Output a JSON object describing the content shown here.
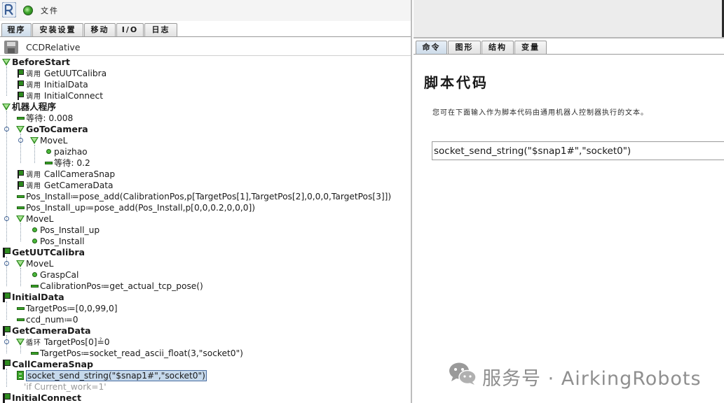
{
  "titlebar": {
    "file_menu": "文件"
  },
  "main_tabs": [
    "程序",
    "安装设置",
    "移动",
    "I/O",
    "日志"
  ],
  "program": {
    "name": "CCDRelative"
  },
  "tree": [
    {
      "indent": 0,
      "icon": "triangle",
      "bold": true,
      "text": "BeforeStart"
    },
    {
      "indent": 1,
      "icon": "flag",
      "kw": "调用",
      "text": "GetUUTCalibra"
    },
    {
      "indent": 1,
      "icon": "flag",
      "kw": "调用",
      "text": "InitialData"
    },
    {
      "indent": 1,
      "icon": "flag",
      "kw": "调用",
      "text": "InitialConnect"
    },
    {
      "indent": 0,
      "icon": "triangle",
      "bold": true,
      "text": "机器人程序"
    },
    {
      "indent": 1,
      "icon": "dash",
      "text": "等待: 0.008"
    },
    {
      "indent": 1,
      "icon": "triangle",
      "bold": true,
      "text": "GoToCamera",
      "knob": true
    },
    {
      "indent": 2,
      "icon": "triangle",
      "text": "MoveL",
      "knob": true
    },
    {
      "indent": 3,
      "icon": "dot",
      "text": "paizhao"
    },
    {
      "indent": 3,
      "icon": "dash",
      "text": "等待: 0.2"
    },
    {
      "indent": 1,
      "icon": "flag",
      "kw": "调用",
      "text": "CallCameraSnap"
    },
    {
      "indent": 1,
      "icon": "flag",
      "kw": "调用",
      "text": "GetCameraData"
    },
    {
      "indent": 1,
      "icon": "dash",
      "text": "Pos_Install≔pose_add(CalibrationPos,p[TargetPos[1],TargetPos[2],0,0,0,TargetPos[3]])"
    },
    {
      "indent": 1,
      "icon": "dash",
      "text": "Pos_Install_up≔pose_add(Pos_Install,p[0,0,0.2,0,0,0])"
    },
    {
      "indent": 1,
      "icon": "triangle",
      "text": "MoveL",
      "knob": true
    },
    {
      "indent": 2,
      "icon": "dot",
      "text": "Pos_Install_up"
    },
    {
      "indent": 2,
      "icon": "dot",
      "text": "Pos_Install"
    },
    {
      "indent": 0,
      "icon": "bigflag",
      "bold": true,
      "text": "GetUUTCalibra"
    },
    {
      "indent": 1,
      "icon": "triangle",
      "text": "MoveL",
      "knob": true
    },
    {
      "indent": 2,
      "icon": "dot",
      "text": "GraspCal"
    },
    {
      "indent": 2,
      "icon": "dash",
      "text": "CalibrationPos≔get_actual_tcp_pose()"
    },
    {
      "indent": 0,
      "icon": "bigflag",
      "bold": true,
      "text": "InitialData"
    },
    {
      "indent": 1,
      "icon": "dash",
      "text": "TargetPos≔[0,0,99,0]"
    },
    {
      "indent": 1,
      "icon": "dash",
      "text": "ccd_num≔0"
    },
    {
      "indent": 0,
      "icon": "bigflag",
      "bold": true,
      "text": "GetCameraData"
    },
    {
      "indent": 1,
      "icon": "triangle",
      "kw": "循环",
      "text": "TargetPos[0]≟0",
      "knob": true
    },
    {
      "indent": 2,
      "icon": "dash",
      "text": "TargetPos≔socket_read_ascii_float(3,\"socket0\")"
    },
    {
      "indent": 0,
      "icon": "bigflag",
      "bold": true,
      "text": "CallCameraSnap"
    },
    {
      "indent": 1,
      "icon": "script",
      "text": "socket_send_string(\"$snap1#\",\"socket0\")",
      "selected": true
    },
    {
      "indent": 1,
      "icon": "none",
      "text": "'if Current_work=1'",
      "faded": true
    },
    {
      "indent": 0,
      "icon": "bigflag",
      "bold": true,
      "text": "InitialConnect"
    }
  ],
  "sub_tabs": [
    "命令",
    "图形",
    "结构",
    "变量"
  ],
  "script_panel": {
    "title": "脚本代码",
    "description": "您可在下面输入作为脚本代码由通用机器人控制器执行的文本。",
    "code": "socket_send_string(\"$snap1#\",\"socket0\")"
  },
  "watermark": {
    "text": "服务号 · AirkingRobots"
  }
}
